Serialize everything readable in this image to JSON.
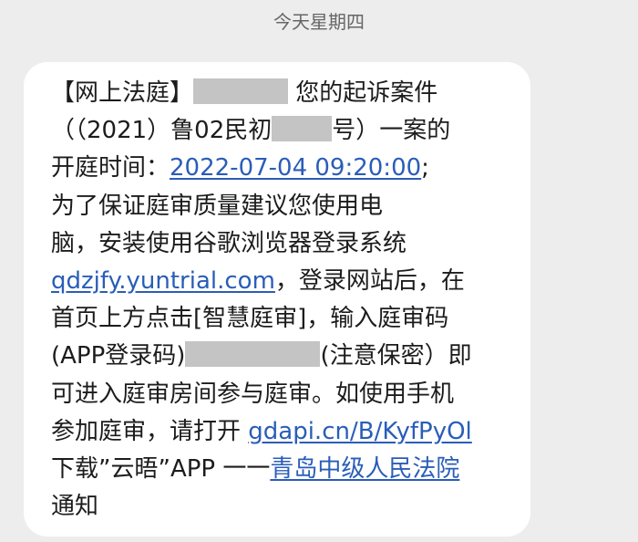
{
  "header": {
    "date": "今天星期四"
  },
  "message": {
    "line1_prefix": "【网上法庭】",
    "line1_suffix": " 您的起诉案件",
    "line2_prefix": "（（2021）鲁02民初",
    "line2_suffix": "号）一案的",
    "line3_prefix": "开庭时间：",
    "hearing_time": "2022-07-04 09:20:00",
    "line3_suffix": ";",
    "line4": "为了保证庭审质量建议您使用电",
    "line5": "脑，安装使用谷歌浏览器登录系统",
    "login_url": "qdzjfy.yuntrial.com",
    "line6_suffix": "，登录网站后，在",
    "line7": "首页上方点击[智慧庭审]，输入庭审码",
    "line8_prefix": "(APP登录码)",
    "line8_suffix": "(注意保密）即",
    "line9": "可进入庭审房间参与庭审。如使用手机",
    "line10_prefix": "参加庭审，请打开 ",
    "app_url": "gdapi.cn/B/KyfPyOl",
    "line11_prefix": "下载”云晤”APP 一一",
    "court_name": "青岛中级人民法院",
    "line12": "通知"
  },
  "colors": {
    "link": "#2a5db8",
    "redaction": "#c4c4c4",
    "bubble": "#ffffff",
    "background": "#ededed"
  }
}
